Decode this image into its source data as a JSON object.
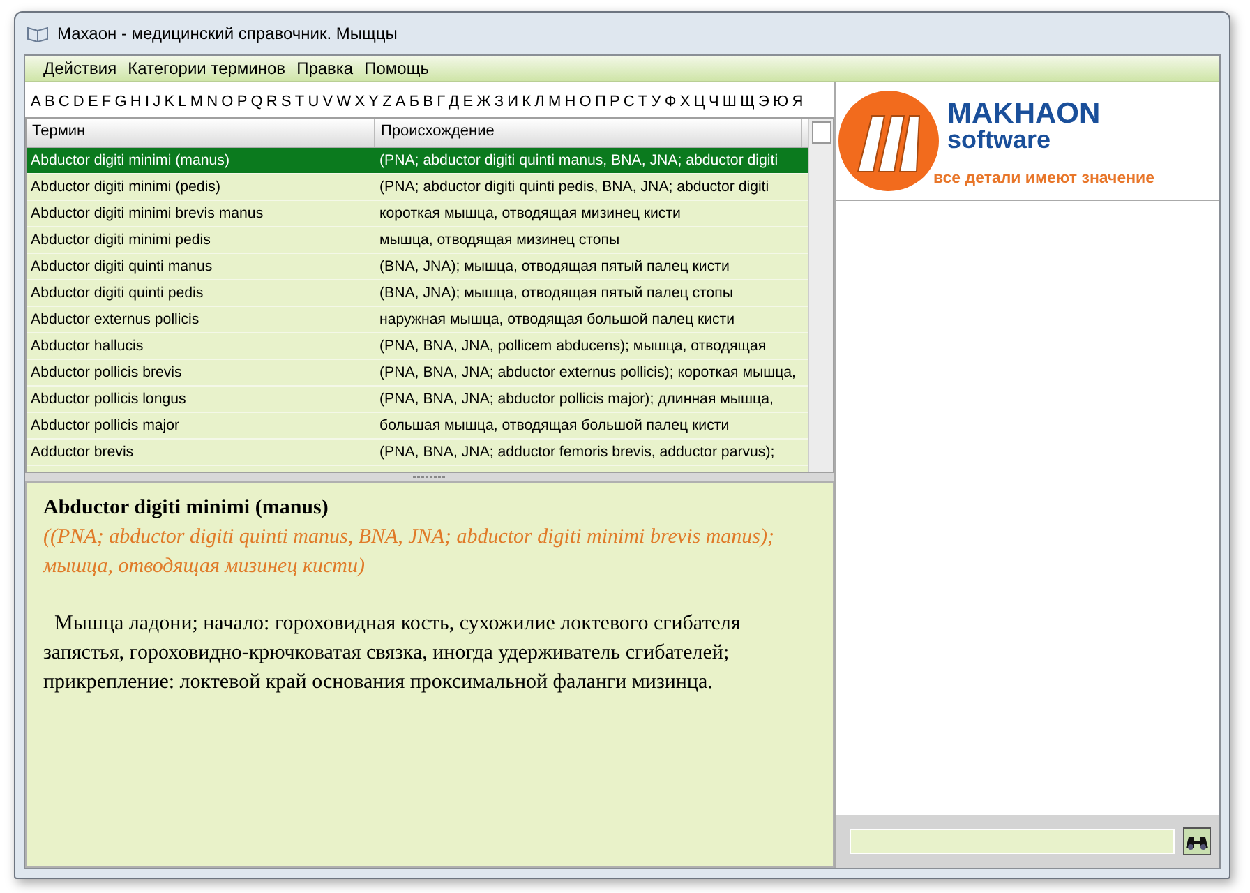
{
  "window": {
    "title": "Махаон - медицинский справочник. Мыщцы"
  },
  "menu": [
    "Действия",
    "Категории терминов",
    "Правка",
    "Помощь"
  ],
  "alphabet": [
    "A",
    "B",
    "C",
    "D",
    "E",
    "F",
    "G",
    "H",
    "I",
    "J",
    "K",
    "L",
    "M",
    "N",
    "O",
    "P",
    "Q",
    "R",
    "S",
    "T",
    "U",
    "V",
    "W",
    "X",
    "Y",
    "Z",
    "А",
    "Б",
    "В",
    "Г",
    "Д",
    "Е",
    "Ж",
    "З",
    "И",
    "К",
    "Л",
    "М",
    "Н",
    "О",
    "П",
    "Р",
    "С",
    "Т",
    "У",
    "Ф",
    "Х",
    "Ц",
    "Ч",
    "Ш",
    "Щ",
    "Э",
    "Ю",
    "Я"
  ],
  "table": {
    "columns": [
      "Термин",
      "Происхождение"
    ],
    "rows": [
      {
        "term": "Abductor digiti minimi (manus)",
        "origin": "(PNA; abductor digiti quinti manus, BNA, JNA; abductor digiti",
        "selected": true
      },
      {
        "term": "Abductor digiti minimi (pedis)",
        "origin": "(PNA; abductor digiti quinti pedis, BNA, JNA; abductor digiti",
        "selected": false
      },
      {
        "term": "Abductor digiti minimi brevis manus",
        "origin": "короткая мышца, отводящая мизинец кисти",
        "selected": false
      },
      {
        "term": "Abductor digiti minimi pedis",
        "origin": "мышца, отводящая мизинец стопы",
        "selected": false
      },
      {
        "term": "Abductor digiti quinti manus",
        "origin": "(BNA, JNA); мышца, отводящая пятый палец кисти",
        "selected": false
      },
      {
        "term": "Abductor digiti quinti pedis",
        "origin": "(BNA, JNA); мышца, отводящая пятый палец стопы",
        "selected": false
      },
      {
        "term": "Abductor externus pollicis",
        "origin": "наружная мышца, отводящая большой палец кисти",
        "selected": false
      },
      {
        "term": "Abductor hallucis",
        "origin": "(PNA, BNA, JNA, pollicem abducens); мышца, отводящая",
        "selected": false
      },
      {
        "term": "Abductor pollicis brevis",
        "origin": "(PNA, BNA, JNA; abductor externus pollicis); короткая мышца,",
        "selected": false
      },
      {
        "term": "Abductor pollicis longus",
        "origin": "(PNA, BNA, JNA; abductor pollicis major); длинная мышца,",
        "selected": false
      },
      {
        "term": "Abductor pollicis major",
        "origin": "большая мышца, отводящая большой палец кисти",
        "selected": false
      },
      {
        "term": "Adductor brevis",
        "origin": "(PNA, BNA, JNA; adductor femoris brevis, adductor parvus);",
        "selected": false
      }
    ]
  },
  "detail": {
    "title": "Abductor digiti minimi (manus)",
    "origin": "((PNA; abductor digiti quinti manus, BNA, JNA; abductor digiti minimi brevis manus); мышца, отводящая мизинец кисти)",
    "body": "Мышца ладони; начало: гороховидная кость, сухожилие локтевого сгибателя запястья, гороховидно-крючковатая связка, иногда удерживатель сгибателей; прикрепление: локтевой край основания проксимальной фаланги мизинца."
  },
  "logo": {
    "name": "MAKHAON",
    "subtitle": "software",
    "slogan": "все детали имеют значение"
  }
}
